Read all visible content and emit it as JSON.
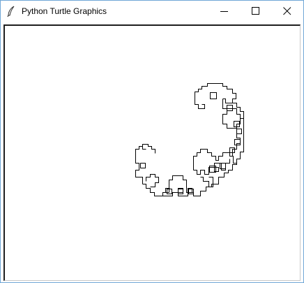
{
  "window": {
    "title": "Python Turtle Graphics",
    "icon": "feather-icon",
    "controls": [
      "minimize-icon",
      "maximize-icon",
      "close-icon"
    ]
  },
  "colors": {
    "window_border": "#6fa7d6",
    "canvas_background": "#ffffff",
    "pen": "#000000"
  }
}
